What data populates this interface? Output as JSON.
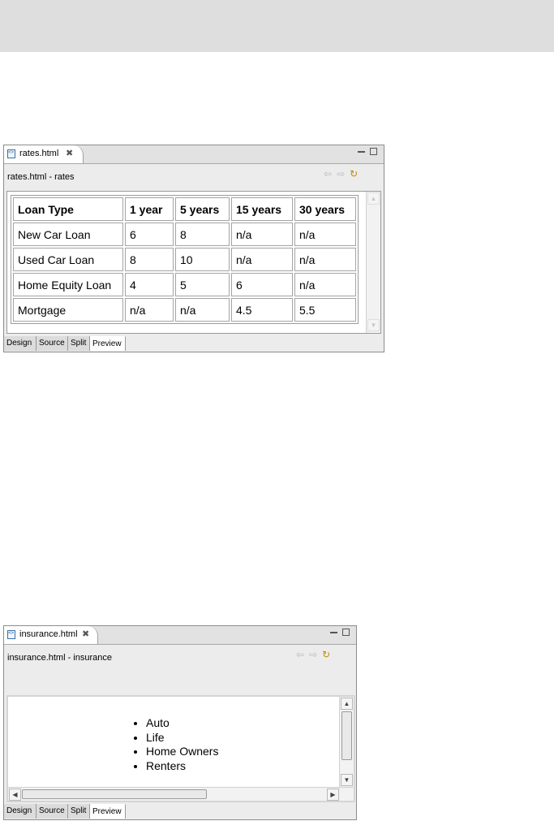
{
  "rates_window": {
    "tab_label": "rates.html",
    "subtitle": "rates.html - rates",
    "table": {
      "headers": [
        "Loan Type",
        "1 year",
        "5 years",
        "15 years",
        "30 years"
      ],
      "rows": [
        [
          "New Car Loan",
          "6",
          "8",
          "n/a",
          "n/a"
        ],
        [
          "Used Car Loan",
          "8",
          "10",
          "n/a",
          "n/a"
        ],
        [
          "Home Equity Loan",
          "4",
          "5",
          "6",
          "n/a"
        ],
        [
          "Mortgage",
          "n/a",
          "n/a",
          "4.5",
          "5.5"
        ]
      ]
    },
    "bottom_tabs": [
      "Design",
      "Source",
      "Split",
      "Preview"
    ],
    "active_tab": "Preview"
  },
  "insurance_window": {
    "tab_label": "insurance.html",
    "subtitle": "insurance.html - insurance",
    "list_items": [
      "Auto",
      "Life",
      "Home Owners",
      "Renters"
    ],
    "bottom_tabs": [
      "Design",
      "Source",
      "Split",
      "Preview"
    ],
    "active_tab": "Preview"
  },
  "icons": {
    "close": "close-icon",
    "back": "back-arrow-icon",
    "forward": "forward-arrow-icon",
    "refresh": "refresh-icon",
    "file": "html-file-icon"
  }
}
